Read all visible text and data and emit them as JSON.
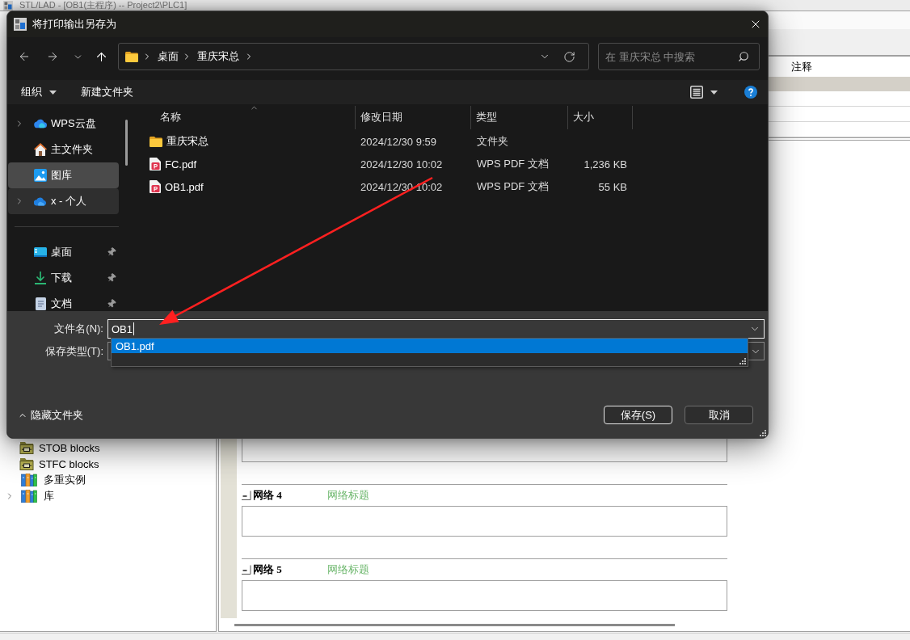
{
  "app": {
    "title": "STL/LAD - [OB1(主程序) -- Project2\\PLC1]",
    "declaration_table": {
      "column_header": "注释"
    },
    "tree": [
      {
        "label": "STOB blocks",
        "kind": "block_folder",
        "expandable": false
      },
      {
        "label": "STFC blocks",
        "kind": "block_folder",
        "expandable": false
      },
      {
        "label": "多重实例",
        "kind": "library",
        "expandable": false
      },
      {
        "label": "库",
        "kind": "library",
        "expandable": true
      }
    ],
    "networks": [
      {
        "label": "网络 4",
        "title": "网络标题"
      },
      {
        "label": "网络 5",
        "title": "网络标题"
      }
    ]
  },
  "dialog": {
    "title": "将打印输出另存为",
    "breadcrumbs": [
      "桌面",
      "重庆宋总"
    ],
    "search": {
      "placeholder": "在 重庆宋总 中搜索"
    },
    "toolbar": {
      "organize": "组织",
      "new_folder": "新建文件夹"
    },
    "nav": {
      "locations": [
        {
          "label": "WPS云盘",
          "kind": "cloud",
          "expandable": true,
          "selected": false,
          "hovered": false
        },
        {
          "label": "主文件夹",
          "kind": "home",
          "expandable": false,
          "selected": false,
          "hovered": false
        },
        {
          "label": "图库",
          "kind": "gallery",
          "expandable": false,
          "selected": true,
          "hovered": false
        },
        {
          "label": "x - 个人",
          "kind": "onedrive",
          "expandable": true,
          "selected": false,
          "hovered": true
        }
      ],
      "quick_access": [
        {
          "label": "桌面",
          "kind": "desktop",
          "pinned": true
        },
        {
          "label": "下载",
          "kind": "downloads",
          "pinned": true
        },
        {
          "label": "文档",
          "kind": "documents",
          "pinned": true
        }
      ]
    },
    "columns": [
      {
        "label": "名称",
        "sorted": true
      },
      {
        "label": "修改日期",
        "sorted": false
      },
      {
        "label": "类型",
        "sorted": false
      },
      {
        "label": "大小",
        "sorted": false
      }
    ],
    "files": [
      {
        "name": "重庆宋总",
        "kind": "folder",
        "modified": "2024/12/30 9:59",
        "type": "文件夹"
      },
      {
        "name": "FC.pdf",
        "kind": "pdf",
        "modified": "2024/12/30 10:02",
        "type": "WPS PDF 文档",
        "size": "1,236 KB"
      },
      {
        "name": "OB1.pdf",
        "kind": "pdf",
        "modified": "2024/12/30 10:02",
        "type": "WPS PDF 文档",
        "size": "55 KB"
      }
    ],
    "filename": {
      "label": "文件名(N):",
      "value": "OB1",
      "focused": true
    },
    "filetype": {
      "label": "保存类型(T):"
    },
    "suggestions": [
      {
        "text": "OB1.pdf",
        "selected": true
      }
    ],
    "hide_folders": "隐藏文件夹",
    "buttons": [
      {
        "label": "保存(S)",
        "default": true
      },
      {
        "label": "取消",
        "default": false
      }
    ]
  }
}
